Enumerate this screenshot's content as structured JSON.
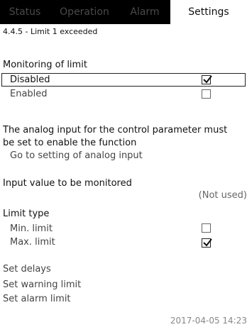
{
  "tabs": [
    {
      "label": "Status",
      "active": false
    },
    {
      "label": "Operation",
      "active": false
    },
    {
      "label": "Alarm",
      "active": false
    },
    {
      "label": "Settings",
      "active": true
    }
  ],
  "breadcrumb": "4.4.5 - Limit 1 exceeded",
  "monitoring": {
    "heading": "Monitoring of limit",
    "options": [
      {
        "label": "Disabled",
        "checked": true,
        "selected": true
      },
      {
        "label": "Enabled",
        "checked": false,
        "selected": false
      }
    ]
  },
  "info": {
    "line1": "The analog input for the control parameter must",
    "line2": "be set to enable the function",
    "link": "Go to setting of analog input"
  },
  "input_value": {
    "label": "Input value to be monitored",
    "value": "(Not used)"
  },
  "limit_type": {
    "heading": "Limit type",
    "options": [
      {
        "label": "Min. limit",
        "checked": false
      },
      {
        "label": "Max. limit",
        "checked": true
      }
    ]
  },
  "actions": {
    "set_delays": "Set delays",
    "set_warning_limit": "Set warning limit",
    "set_alarm_limit": "Set alarm limit"
  },
  "timestamp": "2017-04-05 14:23"
}
